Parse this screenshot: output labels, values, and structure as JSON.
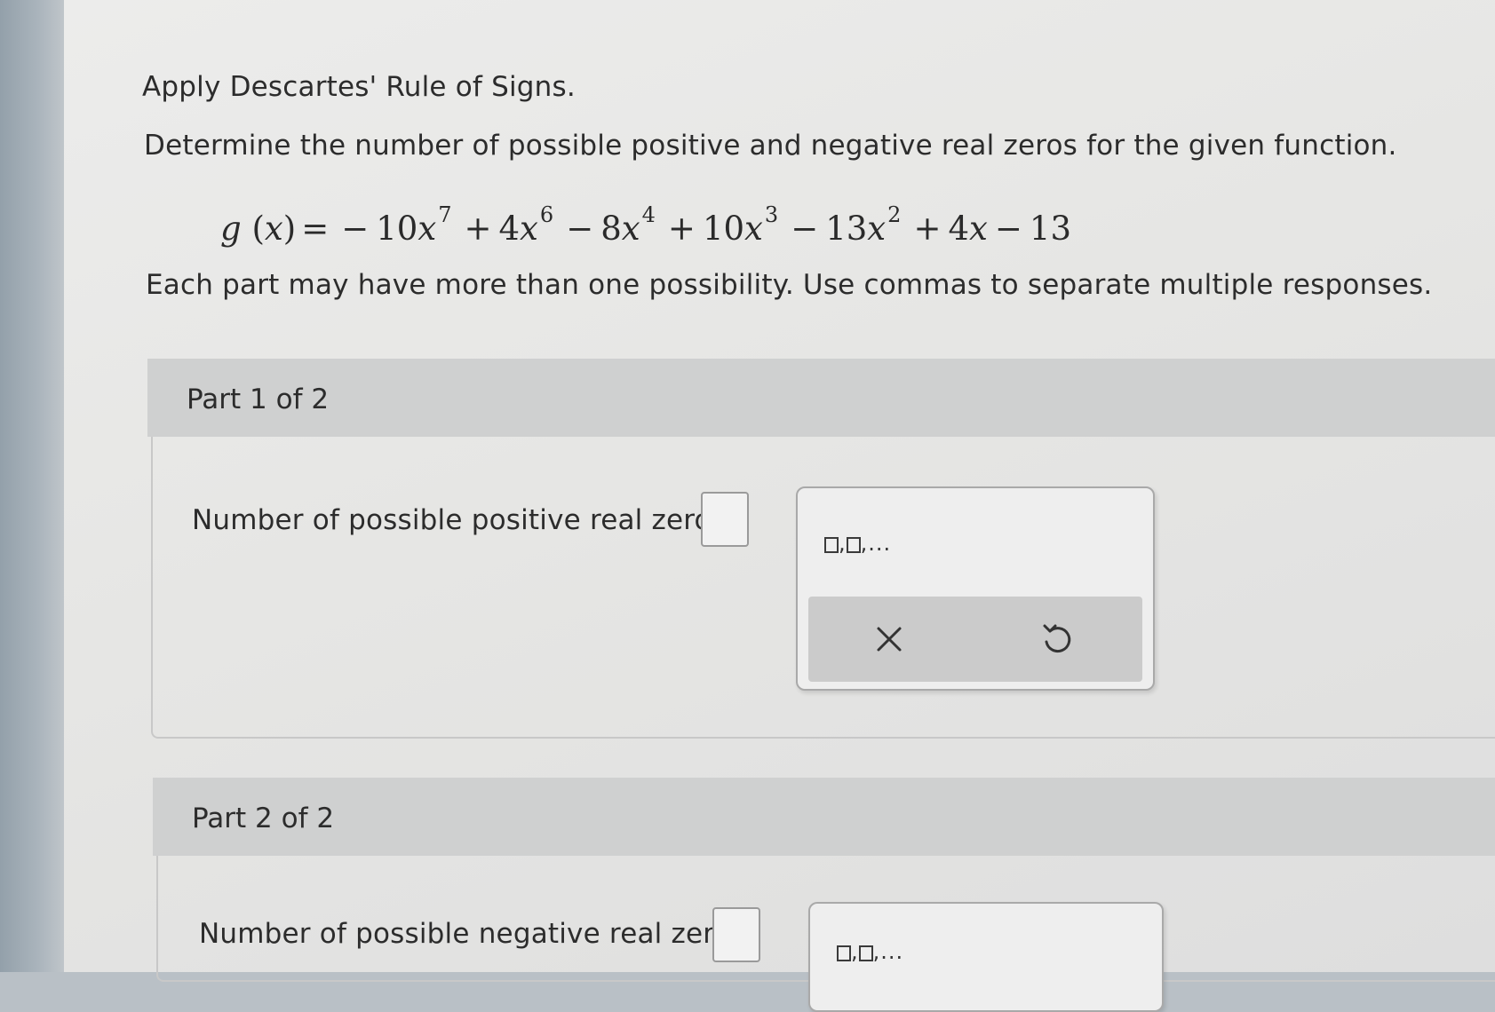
{
  "intro": {
    "title": "Apply Descartes' Rule of Signs.",
    "instruction": "Determine the number of possible positive and negative real zeros for the given function.",
    "function": {
      "lhs_name": "g",
      "variable": "x",
      "equals_sign": "=",
      "terms": [
        {
          "op": "−",
          "coef": "10",
          "exp": "7"
        },
        {
          "op": "+",
          "coef": "4",
          "exp": "6"
        },
        {
          "op": "−",
          "coef": "8",
          "exp": "4"
        },
        {
          "op": "+",
          "coef": "10",
          "exp": "3"
        },
        {
          "op": "−",
          "coef": "13",
          "exp": "2"
        },
        {
          "op": "+",
          "coef": "4",
          "exp": ""
        },
        {
          "op": "−",
          "coef": "13",
          "exp": null
        }
      ]
    },
    "note": "Each part may have more than one possibility. Use commas to separate multiple responses."
  },
  "part1": {
    "header": "Part 1 of 2",
    "prompt": "Number of possible positive real zeros:",
    "answer_value": "",
    "palette": {
      "format_hint_separator": ",",
      "format_hint_ellipsis": "...",
      "clear_icon": "close-icon",
      "undo_icon": "undo-icon"
    }
  },
  "part2": {
    "header": "Part 2 of 2",
    "prompt": "Number of possible negative real zeros:",
    "answer_value": "",
    "palette": {
      "format_hint_separator": ",",
      "format_hint_ellipsis": "..."
    }
  }
}
